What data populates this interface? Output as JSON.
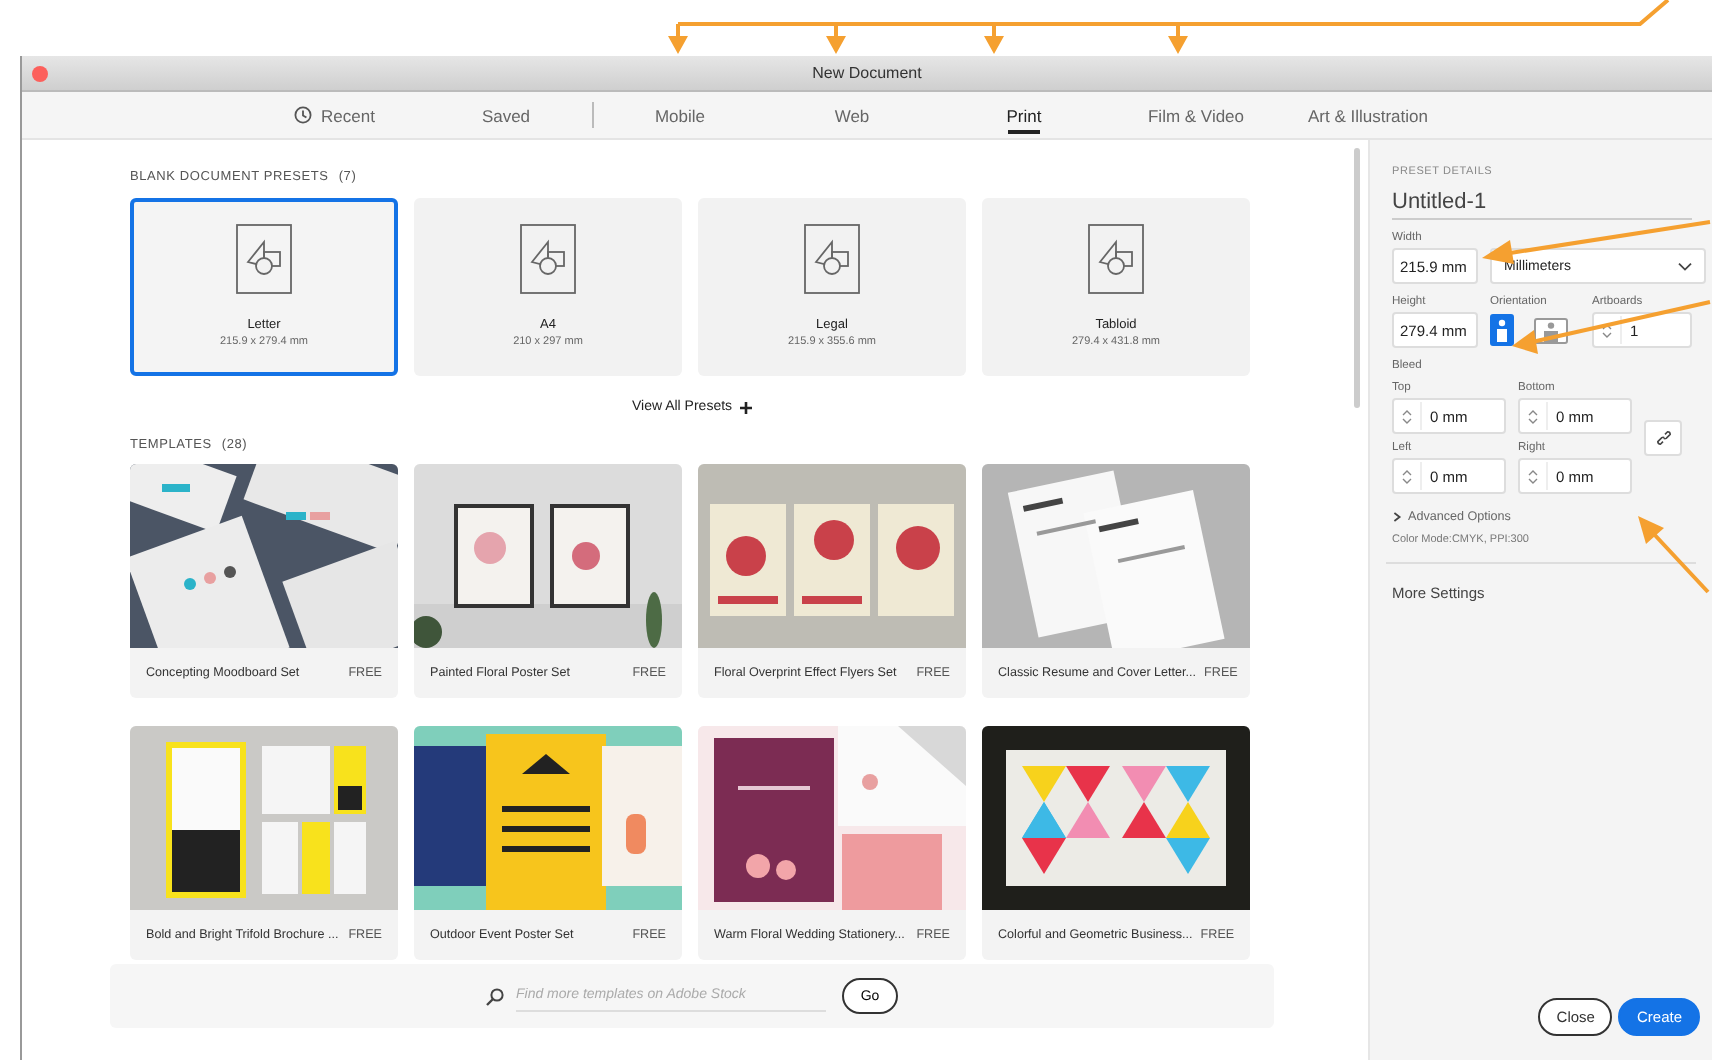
{
  "window": {
    "title": "New Document"
  },
  "tabs": [
    {
      "label": "Recent",
      "kind": "history",
      "selected": false
    },
    {
      "label": "Saved",
      "kind": "plain",
      "selected": false
    },
    {
      "label": "Mobile",
      "kind": "plain",
      "selected": false
    },
    {
      "label": "Web",
      "kind": "plain",
      "selected": false
    },
    {
      "label": "Print",
      "kind": "plain",
      "selected": true
    },
    {
      "label": "Film & Video",
      "kind": "plain",
      "selected": false
    },
    {
      "label": "Art & Illustration",
      "kind": "plain",
      "selected": false
    }
  ],
  "presets": {
    "title": "BLANK DOCUMENT PRESETS",
    "count": "(7)",
    "items": [
      {
        "name": "Letter",
        "size": "215.9 x 279.4 mm",
        "selected": true
      },
      {
        "name": "A4",
        "size": "210 x 297 mm",
        "selected": false
      },
      {
        "name": "Legal",
        "size": "215.9 x 355.6 mm",
        "selected": false
      },
      {
        "name": "Tabloid",
        "size": "279.4 x 431.8 mm",
        "selected": false
      }
    ],
    "view_all": "View All Presets"
  },
  "templates": {
    "title": "TEMPLATES",
    "count": "(28)",
    "items": [
      {
        "name": "Concepting Moodboard Set",
        "badge": "FREE",
        "kind": "picture"
      },
      {
        "name": "Painted Floral Poster Set",
        "badge": "FREE",
        "kind": "picture"
      },
      {
        "name": "Floral Overprint Effect Flyers Set",
        "badge": "FREE",
        "kind": "picture"
      },
      {
        "name": "Classic Resume and Cover Letter...",
        "badge": "FREE",
        "kind": "picture"
      },
      {
        "name": "Bold and Bright Trifold Brochure ...",
        "badge": "FREE",
        "kind": "picture"
      },
      {
        "name": "Outdoor Event Poster Set",
        "badge": "FREE",
        "kind": "picture"
      },
      {
        "name": "Warm Floral Wedding Stationery...",
        "badge": "FREE",
        "kind": "picture"
      },
      {
        "name": "Colorful and Geometric Business...",
        "badge": "FREE",
        "kind": "picture"
      }
    ]
  },
  "search": {
    "placeholder": "Find more templates on Adobe Stock",
    "button": "Go"
  },
  "details": {
    "title": "PRESET DETAILS",
    "name": "Untitled-1",
    "width": {
      "label": "Width",
      "value": "215.9 mm"
    },
    "units": {
      "value": "Millimeters"
    },
    "height": {
      "label": "Height",
      "value": "279.4 mm"
    },
    "orientation": {
      "label": "Orientation",
      "options": [
        {
          "kind": "portrait",
          "selected": true
        },
        {
          "kind": "landscape",
          "selected": false
        }
      ]
    },
    "artboards": {
      "label": "Artboards",
      "value": "1"
    },
    "bleed": {
      "label": "Bleed",
      "fields": [
        {
          "label": "Top",
          "value": "0 mm"
        },
        {
          "label": "Bottom",
          "value": "0 mm"
        },
        {
          "label": "Left",
          "value": "0 mm"
        },
        {
          "label": "Right",
          "value": "0 mm"
        }
      ]
    },
    "advanced": {
      "label": "Advanced Options",
      "expanded": false
    },
    "color_mode": "Color Mode:CMYK, PPI:300",
    "more_settings": "More Settings"
  },
  "buttons": [
    {
      "label": "Close",
      "kind": "secondary"
    },
    {
      "label": "Create",
      "kind": "primary"
    }
  ]
}
